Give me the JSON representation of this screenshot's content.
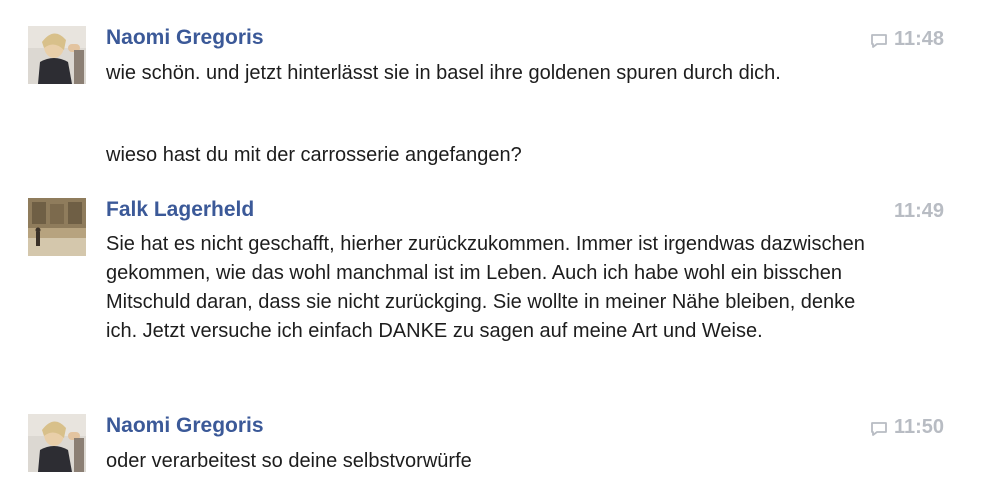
{
  "messages": [
    {
      "sender": "Naomi Gregoris",
      "time": "11:48",
      "has_reply_icon": true,
      "paragraphs": [
        "wie schön. und jetzt hinterlässt sie in basel ihre goldenen spuren durch dich.",
        "wieso hast du mit der carrosserie angefangen?"
      ]
    },
    {
      "sender": "Falk Lagerheld",
      "time": "11:49",
      "has_reply_icon": false,
      "paragraphs": [
        "Sie hat es nicht geschafft, hierher zurückzukommen. Immer ist irgendwas dazwischen gekommen, wie das wohl manchmal ist im Leben. Auch ich habe wohl ein bisschen Mitschuld daran, dass sie nicht zurückging. Sie wollte in meiner Nähe bleiben, denke ich. Jetzt versuche ich einfach DANKE zu sagen auf meine Art und Weise."
      ]
    },
    {
      "sender": "Naomi Gregoris",
      "time": "11:50",
      "has_reply_icon": true,
      "paragraphs": [
        "oder verarbeitest so deine selbstvorwürfe"
      ]
    }
  ],
  "colors": {
    "sender": "#3b5998",
    "time": "#b8bcc3",
    "text": "#1d1d1d"
  }
}
